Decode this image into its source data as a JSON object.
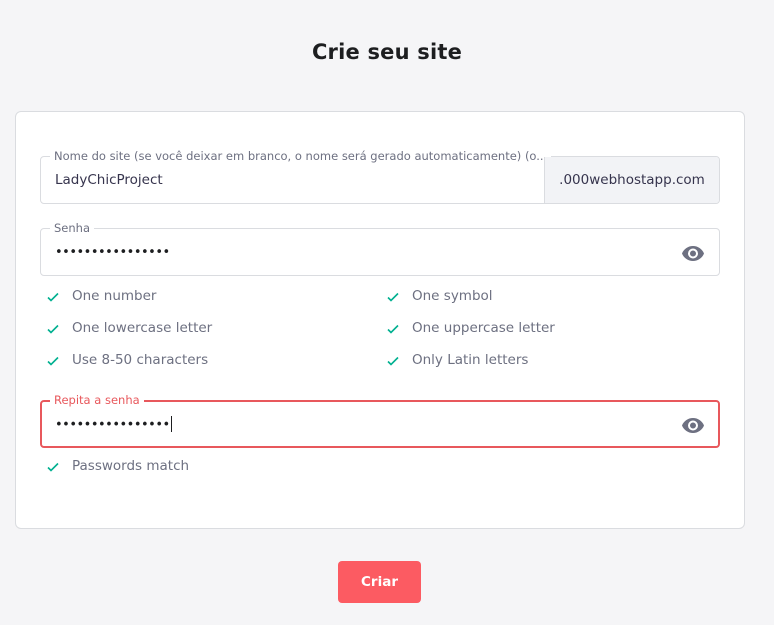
{
  "page": {
    "title": "Crie seu site"
  },
  "site_field": {
    "label": "Nome do site (se você deixar em branco, o nome será gerado automaticamente) (o...",
    "value": "LadyChicProject",
    "suffix": ".000webhostapp.com"
  },
  "password_field": {
    "label": "Senha",
    "value": "••••••••••••••••",
    "visibility_icon": "eye-icon"
  },
  "rules": {
    "one_number": "One number",
    "one_symbol": "One symbol",
    "one_lowercase": "One lowercase letter",
    "one_uppercase": "One uppercase letter",
    "length": "Use 8-50 characters",
    "latin": "Only Latin letters"
  },
  "repeat_field": {
    "label": "Repita a senha",
    "value": "••••••••••••••••",
    "visibility_icon": "eye-icon"
  },
  "match_text": "Passwords match",
  "submit_label": "Criar",
  "colors": {
    "accent": "#fc5b62",
    "error_border": "#e8585c",
    "check": "#00b090"
  }
}
